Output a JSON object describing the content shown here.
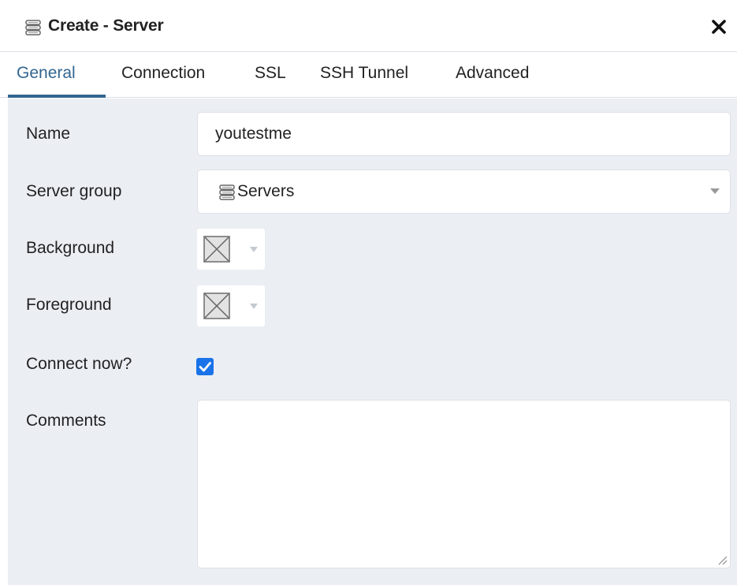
{
  "dialog": {
    "title": "Create - Server",
    "title_icon": "server-icon",
    "close_icon": "close-icon"
  },
  "tabs": [
    {
      "label": "General",
      "active": true
    },
    {
      "label": "Connection",
      "active": false
    },
    {
      "label": "SSL",
      "active": false
    },
    {
      "label": "SSH Tunnel",
      "active": false
    },
    {
      "label": "Advanced",
      "active": false
    }
  ],
  "form": {
    "name": {
      "label": "Name",
      "value": "youtestme"
    },
    "server_group": {
      "label": "Server group",
      "value": "Servers",
      "icon": "server-icon"
    },
    "background": {
      "label": "Background",
      "value": "none"
    },
    "foreground": {
      "label": "Foreground",
      "value": "none"
    },
    "connect_now": {
      "label": "Connect now?",
      "checked": true
    },
    "comments": {
      "label": "Comments",
      "value": ""
    }
  },
  "colors": {
    "accent": "#326690",
    "checkbox": "#1a73e8",
    "panel_background": "#ebeef3"
  }
}
